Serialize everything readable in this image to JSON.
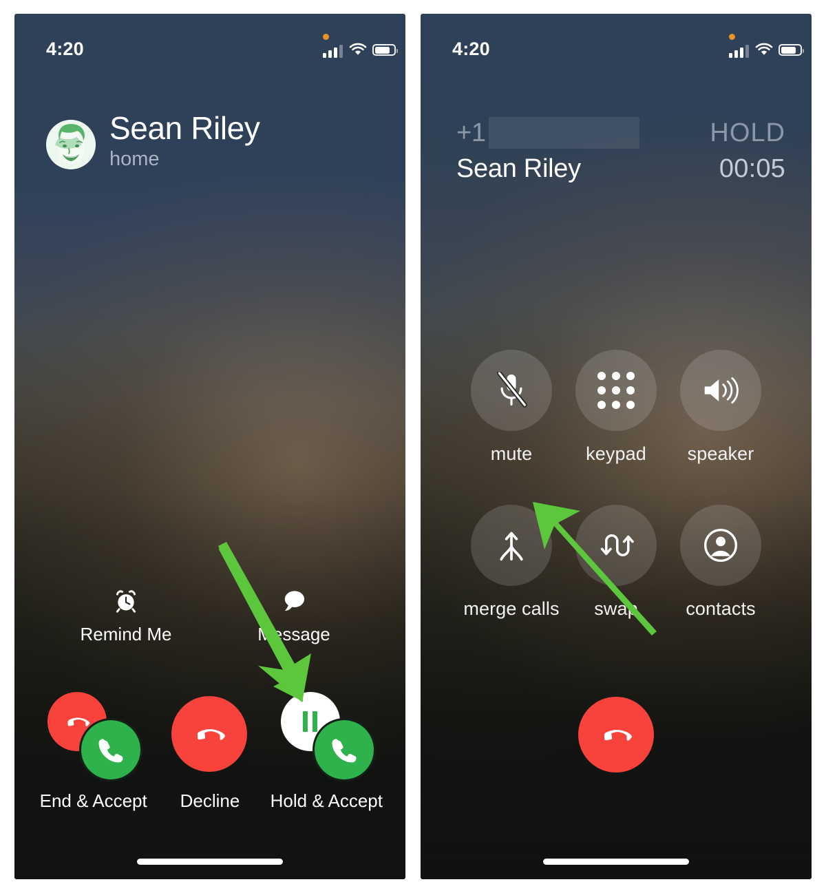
{
  "screens": [
    {
      "id": "incoming-call-while-on-call",
      "status_bar": {
        "time": "4:20",
        "mic_indicator": "orange-dot",
        "signal_icon": "cellular-signal-icon",
        "wifi_icon": "wifi-icon",
        "battery_icon": "battery-icon"
      },
      "caller": {
        "name": "Sean Riley",
        "label": "home",
        "avatar": "contact-avatar"
      },
      "secondary_actions": [
        {
          "label": "Remind Me",
          "icon": "alarm-clock-icon"
        },
        {
          "label": "Message",
          "icon": "speech-bubble-icon"
        }
      ],
      "answer_options": [
        {
          "label": "End & Accept",
          "icons": [
            "end-call-icon",
            "answer-call-icon"
          ]
        },
        {
          "label": "Decline",
          "icons": [
            "decline-call-icon"
          ]
        },
        {
          "label": "Hold & Accept",
          "icons": [
            "hold-pause-icon",
            "answer-call-icon"
          ]
        }
      ],
      "home_indicator": "home-indicator"
    },
    {
      "id": "in-call-two-lines",
      "status_bar": {
        "time": "4:20",
        "mic_indicator": "orange-dot",
        "signal_icon": "cellular-signal-icon",
        "wifi_icon": "wifi-icon",
        "battery_icon": "battery-icon"
      },
      "call_lines": [
        {
          "prefix": "+1",
          "number_redacted": true,
          "state": "HOLD"
        },
        {
          "name": "Sean Riley",
          "timer": "00:05"
        }
      ],
      "controls": [
        {
          "label": "mute",
          "icon": "mute-microphone-icon"
        },
        {
          "label": "keypad",
          "icon": "keypad-dots-icon"
        },
        {
          "label": "speaker",
          "icon": "speaker-icon"
        },
        {
          "label": "merge calls",
          "icon": "merge-calls-icon"
        },
        {
          "label": "swap",
          "icon": "swap-calls-icon"
        },
        {
          "label": "contacts",
          "icon": "contacts-person-icon"
        }
      ],
      "end_call": {
        "label": "",
        "icon": "end-call-icon"
      },
      "home_indicator": "home-indicator"
    }
  ],
  "annotations": [
    {
      "name": "arrow-to-hold-and-accept",
      "color": "#5cc63c",
      "target": "Hold & Accept"
    },
    {
      "name": "arrow-to-merge-calls",
      "color": "#5cc63c",
      "target": "merge calls"
    }
  ],
  "colors": {
    "accent_green": "#2eb24c",
    "decline_red": "#f8433c",
    "annotation_green": "#5cc63c",
    "muted_text": "#8c98a6"
  }
}
